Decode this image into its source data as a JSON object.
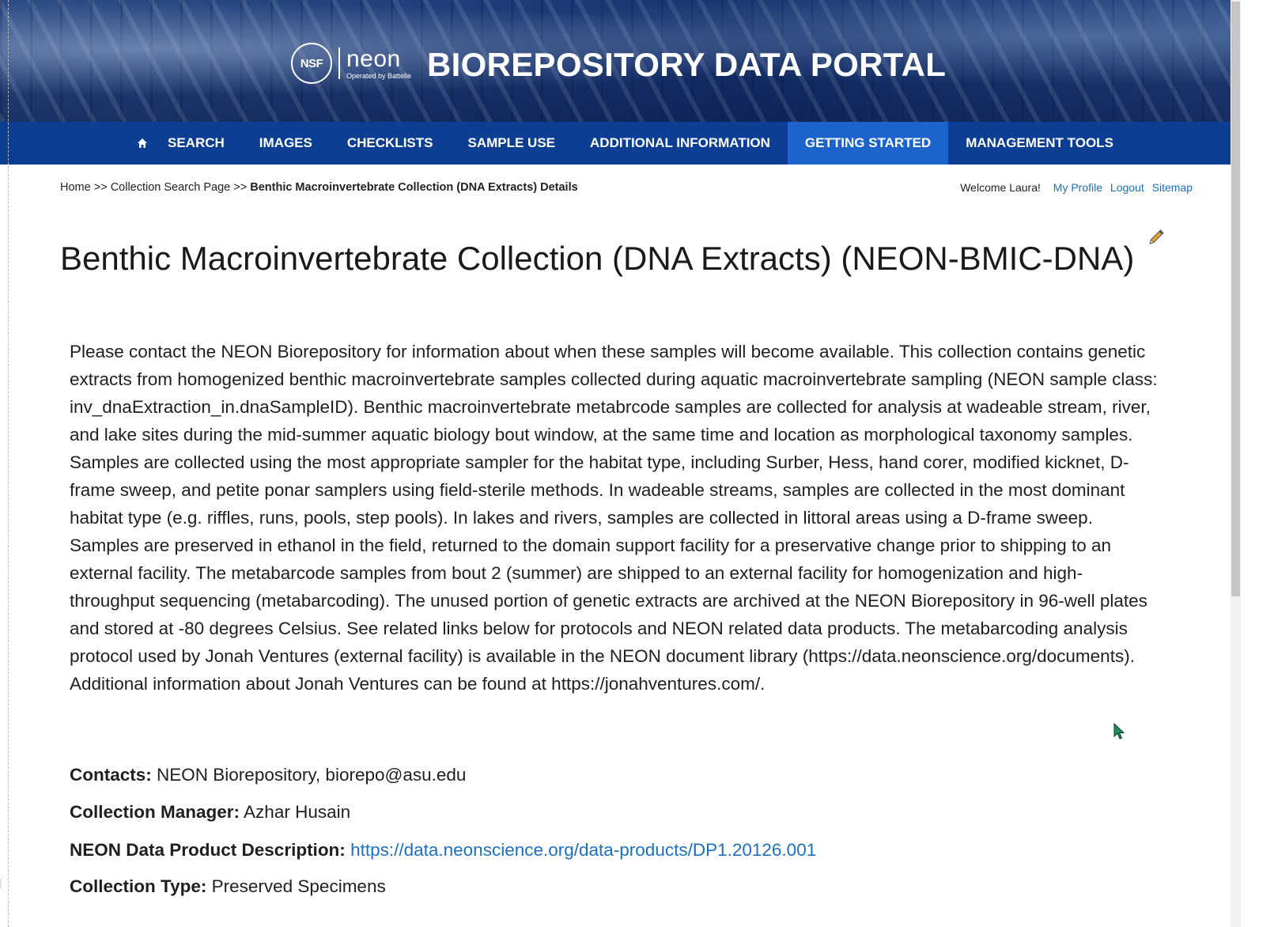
{
  "banner": {
    "nsf_logo": "NSF",
    "neon_logo": "neon",
    "neon_sub": "Operated by Battelle",
    "title": "BIOREPOSITORY DATA PORTAL"
  },
  "nav": {
    "home_icon": "home-icon",
    "items": [
      {
        "label": "SEARCH",
        "active": false
      },
      {
        "label": "IMAGES",
        "active": false
      },
      {
        "label": "CHECKLISTS",
        "active": false
      },
      {
        "label": "SAMPLE USE",
        "active": false
      },
      {
        "label": "ADDITIONAL INFORMATION",
        "active": false
      },
      {
        "label": "GETTING STARTED",
        "active": true
      },
      {
        "label": "MANAGEMENT TOOLS",
        "active": false
      }
    ]
  },
  "breadcrumb": {
    "home": "Home",
    "sep1": ">>",
    "collection_search": "Collection Search Page",
    "sep2": ">>",
    "current": "Benthic Macroinvertebrate Collection (DNA Extracts) Details"
  },
  "userbar": {
    "welcome": "Welcome Laura!",
    "profile": "My Profile",
    "logout": "Logout",
    "sitemap": "Sitemap"
  },
  "page": {
    "title": "Benthic Macroinvertebrate Collection (DNA Extracts) (NEON-BMIC-DNA)",
    "description": "Please contact the NEON Biorepository for information about when these samples will become available. This collection contains genetic extracts from homogenized benthic macroinvertebrate samples collected during aquatic macroinvertebrate sampling (NEON sample class: inv_dnaExtraction_in.dnaSampleID). Benthic macroinvertebrate metabrcode samples are collected for analysis at wadeable stream, river, and lake sites during the mid-summer aquatic biology bout window, at the same time and location as morphological taxonomy samples. Samples are collected using the most appropriate sampler for the habitat type, including Surber, Hess, hand corer, modified kicknet, D-frame sweep, and petite ponar samplers using field-sterile methods. In wadeable streams, samples are collected in the most dominant habitat type (e.g. riffles, runs, pools, step pools). In lakes and rivers, samples are collected in littoral areas using a D-frame sweep. Samples are preserved in ethanol in the field, returned to the domain support facility for a preservative change prior to shipping to an external facility. The metabarcode samples from bout 2 (summer) are shipped to an external facility for homogenization and high-throughput sequencing (metabarcoding). The unused portion of genetic extracts are archived at the NEON Biorepository in 96-well plates and stored at -80 degrees Celsius. See related links below for protocols and NEON related data products. The metabarcoding analysis protocol used by Jonah Ventures (external facility) is available in the NEON document library (https://data.neonscience.org/documents). Additional information about Jonah Ventures can be found at https://jonahventures.com/.",
    "fields": {
      "contacts_label": "Contacts:",
      "contacts_value": "NEON Biorepository, biorepo@asu.edu",
      "manager_label": "Collection Manager:",
      "manager_value": "Azhar Husain",
      "product_label": "NEON Data Product Description:",
      "product_link": "https://data.neonscience.org/data-products/DP1.20126.001",
      "type_label": "Collection Type:",
      "type_value": "Preserved Specimens"
    }
  },
  "colors": {
    "nav_bg": "#0c3f94",
    "nav_active": "#1d63cc",
    "link": "#1a6fc2",
    "cursor_fill": "#1a8f5a"
  },
  "icons": [
    "home-icon",
    "pencil-edit-icon",
    "mouse-cursor-icon",
    "nsf-logo",
    "neon-logo"
  ]
}
